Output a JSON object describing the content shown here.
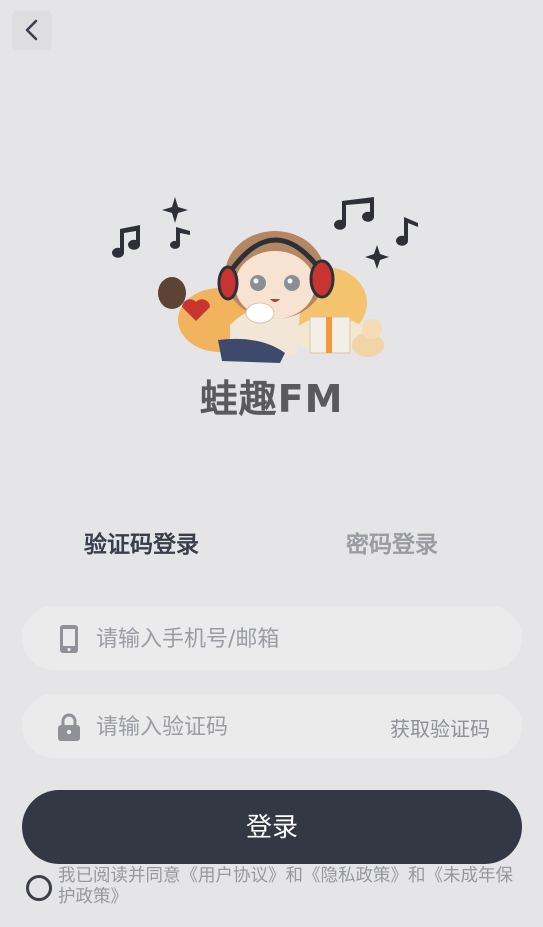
{
  "header": {
    "back_icon": "chevron-left-icon"
  },
  "brand": {
    "name": "蛙趣FM"
  },
  "tabs": [
    {
      "label": "验证码登录",
      "active": true
    },
    {
      "label": "密码登录",
      "active": false
    }
  ],
  "phone_field": {
    "icon": "phone-icon",
    "placeholder": "请输入手机号/邮箱",
    "value": ""
  },
  "code_field": {
    "icon": "lock-icon",
    "placeholder": "请输入验证码",
    "value": "",
    "get_code_label": "获取验证码"
  },
  "login_button": {
    "label": "登录"
  },
  "agreement": {
    "text": "我已阅读并同意《用户协议》和《隐私政策》和《未成年保护政策》"
  },
  "colors": {
    "background": "#e5e5e7",
    "primary_button": "#343845",
    "field_bg": "#ebebec",
    "muted_text": "#96989e"
  }
}
